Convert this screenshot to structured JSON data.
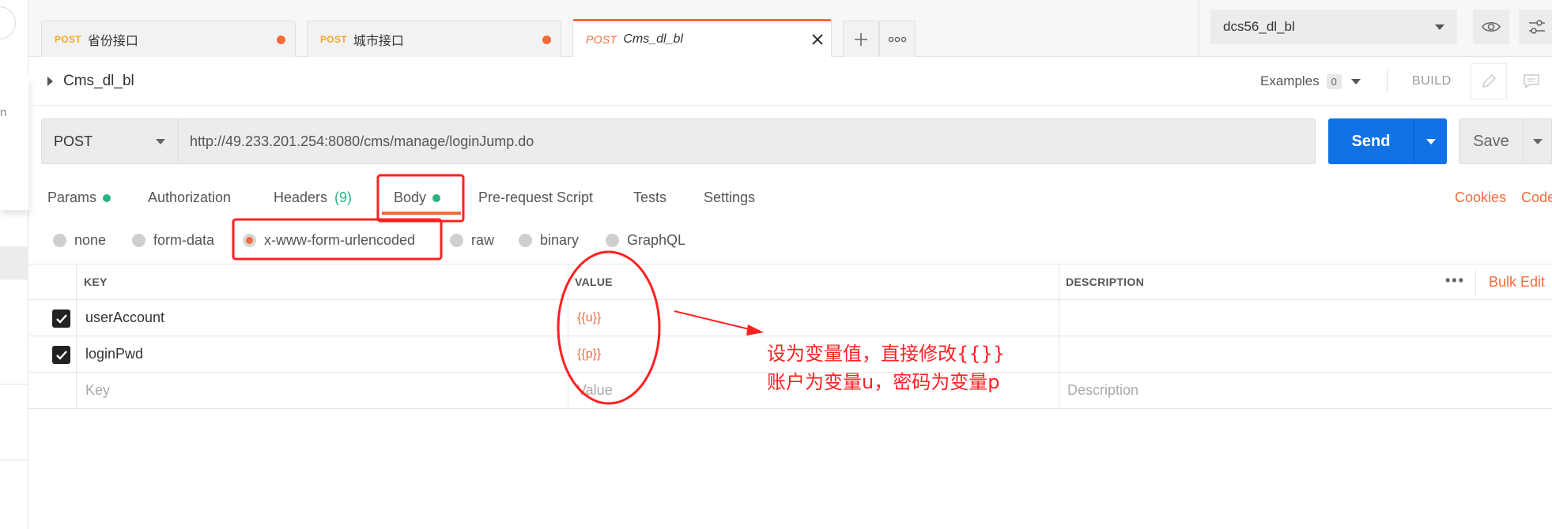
{
  "sidebar": {
    "partial_text": "n"
  },
  "tabs": [
    {
      "method": "POST",
      "name": "省份接口",
      "unsaved": true,
      "active": false
    },
    {
      "method": "POST",
      "name": "城市接口",
      "unsaved": true,
      "active": false
    },
    {
      "method": "POST",
      "name": "Cms_dl_bl",
      "unsaved": false,
      "active": true
    }
  ],
  "environment": {
    "selected": "dcs56_dl_bl"
  },
  "request": {
    "name": "Cms_dl_bl",
    "examples_label": "Examples",
    "examples_count": "0",
    "build_label": "BUILD",
    "method": "POST",
    "url": "http://49.233.201.254:8080/cms/manage/loginJump.do",
    "send_label": "Send",
    "save_label": "Save"
  },
  "request_tabs": {
    "params": "Params",
    "authorization": "Authorization",
    "headers": "Headers",
    "headers_count": "(9)",
    "body": "Body",
    "pre_request": "Pre-request Script",
    "tests": "Tests",
    "settings": "Settings",
    "cookies": "Cookies",
    "code": "Code"
  },
  "body_types": {
    "none": "none",
    "form_data": "form-data",
    "urlencoded": "x-www-form-urlencoded",
    "raw": "raw",
    "binary": "binary",
    "graphql": "GraphQL",
    "selected": "x-www-form-urlencoded"
  },
  "table": {
    "headers": {
      "key": "KEY",
      "value": "VALUE",
      "description": "DESCRIPTION",
      "bulk_edit": "Bulk Edit"
    },
    "rows": [
      {
        "checked": true,
        "key": "userAccount",
        "value": "{{u}}",
        "description": ""
      },
      {
        "checked": true,
        "key": "loginPwd",
        "value": "{{p}}",
        "description": ""
      }
    ],
    "placeholders": {
      "key": "Key",
      "value": "Value",
      "description": "Description"
    }
  },
  "annotation": {
    "line1": "设为变量值，直接修改{{}}",
    "line2": "账户为变量u，密码为变量p",
    "color": "#ff2020"
  },
  "colors": {
    "accent": "#f26b3a",
    "send": "#0f72e5",
    "green": "#26b47f",
    "post_tab": "#f5a623"
  }
}
